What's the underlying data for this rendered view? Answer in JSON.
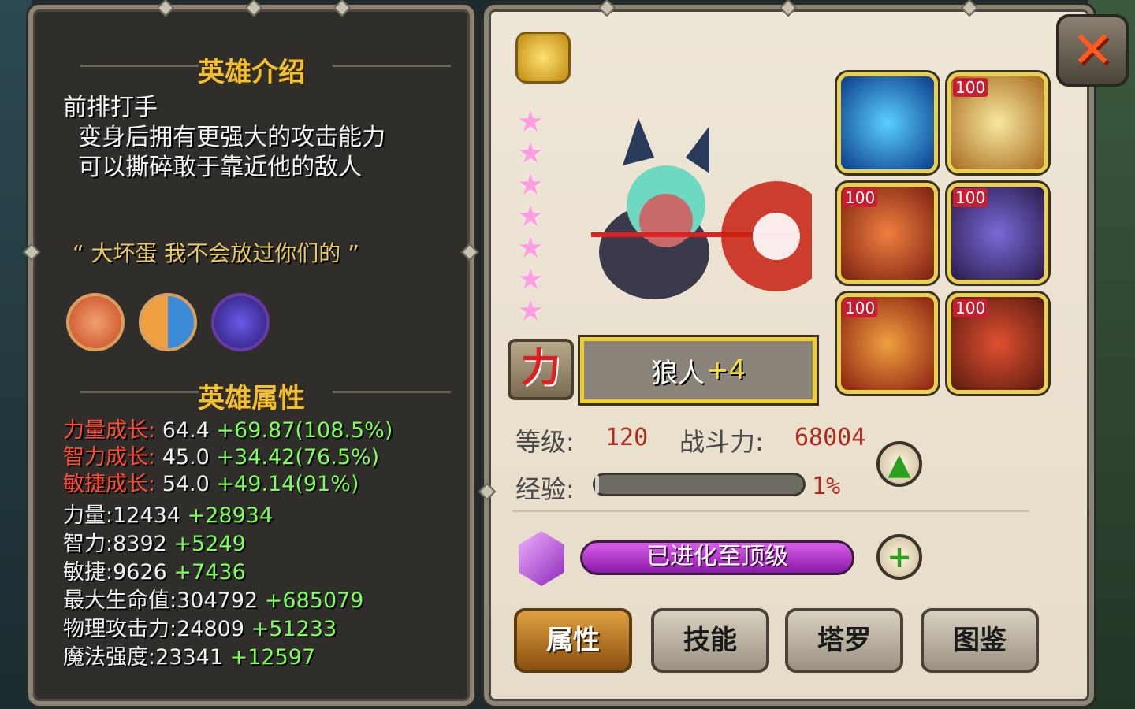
{
  "intro": {
    "title": "英雄介绍",
    "text": "前排打手\n  变身后拥有更强大的攻击能力\n  可以撕碎敢于靠近他的敌人",
    "quote": "“ 大坏蛋 我不会放过你们的 ”"
  },
  "skills": [
    "wreath-skill-icon",
    "dual-face-skill-icon",
    "cosmic-head-skill-icon"
  ],
  "attributes": {
    "title": "英雄属性",
    "growth": [
      {
        "label": "力量成长:",
        "base": "64.4",
        "bonus": "+69.87(108.5%)"
      },
      {
        "label": "智力成长:",
        "base": "45.0",
        "bonus": "+34.42(76.5%)"
      },
      {
        "label": "敏捷成长:",
        "base": "54.0",
        "bonus": "+49.14(91%)"
      }
    ],
    "stats": [
      {
        "label": "力量:",
        "base": "12434",
        "bonus": "+28934"
      },
      {
        "label": "智力:",
        "base": "8392",
        "bonus": "+5249"
      },
      {
        "label": "敏捷:",
        "base": "9626",
        "bonus": "+7436"
      },
      {
        "label": "最大生命值:",
        "base": "304792",
        "bonus": "+685079"
      },
      {
        "label": "物理攻击力:",
        "base": "24809",
        "bonus": "+51233"
      },
      {
        "label": "魔法强度:",
        "base": "23341",
        "bonus": "+12597"
      }
    ]
  },
  "hero": {
    "class_label": "力",
    "name": "狼人",
    "plus": "+4",
    "stars": 7,
    "level_label": "等级:",
    "level": "120",
    "power_label": "战斗力:",
    "power": "68004",
    "exp_label": "经验:",
    "exp_percent": "1%",
    "exp_fraction": 0.01,
    "evolve_text": "已进化至顶级"
  },
  "equipment": [
    {
      "badge": "",
      "icon": "ice-crown-icon"
    },
    {
      "badge": "100",
      "icon": "skull-mech-icon"
    },
    {
      "badge": "100",
      "icon": "blade-icon"
    },
    {
      "badge": "100",
      "icon": "purple-sword-icon"
    },
    {
      "badge": "100",
      "icon": "battle-axe-icon"
    },
    {
      "badge": "100",
      "icon": "demon-helm-icon"
    }
  ],
  "tabs": [
    {
      "label": "属性",
      "active": true
    },
    {
      "label": "技能",
      "active": false
    },
    {
      "label": "塔罗",
      "active": false
    },
    {
      "label": "图鉴",
      "active": false
    }
  ],
  "close_label": "✕"
}
